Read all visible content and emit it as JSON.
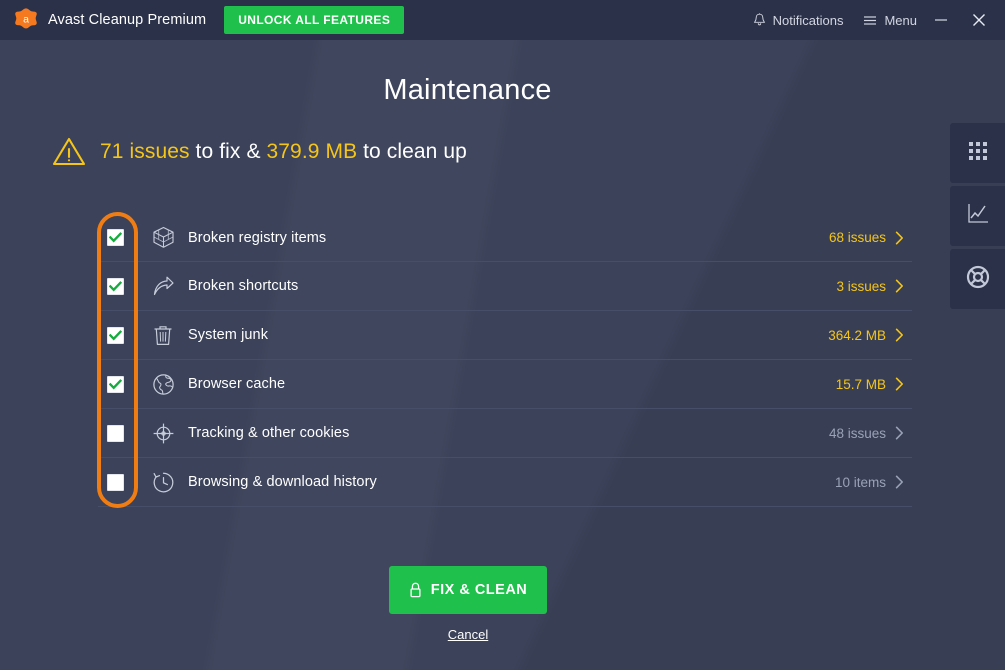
{
  "titlebar": {
    "brand_name": "Avast Cleanup Premium",
    "logo_icon": "avast-logo-icon",
    "unlock_label": "UNLOCK ALL FEATURES",
    "notifications_label": "Notifications",
    "notifications_icon": "bell-icon",
    "menu_label": "Menu",
    "menu_icon": "hamburger-icon",
    "minimize_icon": "minimize-icon",
    "close_icon": "close-icon"
  },
  "header": {
    "title": "Maintenance",
    "warning_icon": "warning-triangle-icon",
    "summary_issues": "71 issues",
    "summary_mid": " to fix & ",
    "summary_size": "379.9 MB",
    "summary_tail": " to clean up"
  },
  "list": {
    "rows": [
      {
        "label": "Broken registry items",
        "icon": "registry-cube-icon",
        "value": "68 issues",
        "checked": true,
        "chevron": "chevron-right-icon"
      },
      {
        "label": "Broken shortcuts",
        "icon": "shortcut-arrow-icon",
        "value": "3 issues",
        "checked": true,
        "chevron": "chevron-right-icon"
      },
      {
        "label": "System junk",
        "icon": "trash-can-icon",
        "value": "364.2 MB",
        "checked": true,
        "chevron": "chevron-right-icon"
      },
      {
        "label": "Browser cache",
        "icon": "globe-icon",
        "value": "15.7 MB",
        "checked": true,
        "chevron": "chevron-right-icon"
      },
      {
        "label": "Tracking & other cookies",
        "icon": "crosshair-icon",
        "value": "48 issues",
        "checked": false,
        "chevron": "chevron-right-icon"
      },
      {
        "label": "Browsing & download history",
        "icon": "clock-history-icon",
        "value": "10 items",
        "checked": false,
        "chevron": "chevron-right-icon"
      }
    ]
  },
  "annotation": {
    "shape": "orange-highlight-ring",
    "color": "#f07d14",
    "targets": "checkbox-column"
  },
  "footer": {
    "fix_label": "FIX & CLEAN",
    "fix_icon": "padlock-icon",
    "cancel_label": "Cancel"
  },
  "sidebar": {
    "items": [
      {
        "icon": "apps-grid-icon",
        "name": "sidebar-tab-apps"
      },
      {
        "icon": "line-chart-icon",
        "name": "sidebar-tab-performance"
      },
      {
        "icon": "life-ring-icon",
        "name": "sidebar-tab-support"
      }
    ]
  },
  "colors": {
    "background": "#3b4259",
    "titlebar": "#2b3148",
    "accent_green": "#1fc04b",
    "accent_gold": "#f5c518",
    "annotation_orange": "#f07d14",
    "muted_text": "#9aa2b8"
  }
}
